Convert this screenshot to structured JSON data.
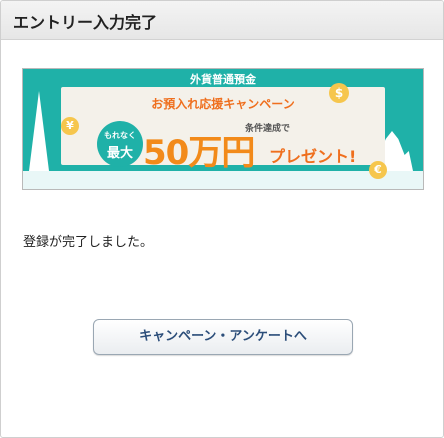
{
  "header": {
    "title": "エントリー入力完了"
  },
  "banner": {
    "top_text": "外貨普通預金",
    "campaign_text": "お預入れ応援キャンペーン",
    "badge_small": "もれなく",
    "badge_big": "最大",
    "condition_text": "条件達成で",
    "amount_text": "50万円",
    "present_text": "プレゼント!",
    "coin_a": "$",
    "coin_b": "¥",
    "coin_c": "€"
  },
  "main": {
    "message": "登録が完了しました。"
  },
  "cta": {
    "label": "キャンペーン・アンケートへ"
  },
  "colors": {
    "teal": "#1fb1a8",
    "orange": "#f28a1a",
    "button_text": "#2c4e7a"
  }
}
